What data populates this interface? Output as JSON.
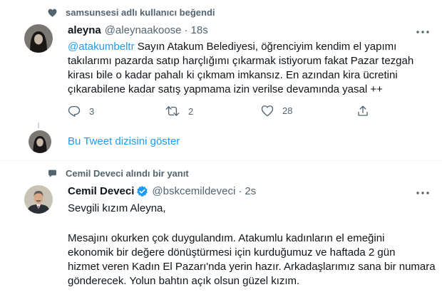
{
  "tweet1": {
    "social_context": "samsunsesi adlı kullanıcı beğendi",
    "author_name": "aleyna",
    "handle": "@aleynaakoose",
    "time": "18s",
    "mention": "@atakumbeltr",
    "lines": [
      " Sayın Atakum Belediyesi, öğrenciyim kendim el yapımı",
      "takılarımı pazarda satıp harçlığımı çıkarmak istiyorum fakat Pazar tezgah",
      "kirası bile o kadar pahalı ki çıkmam imkansız. En azından kira ücretini",
      "çıkarabilene kadar satış yapmama izin verilse devamında yasal ++"
    ],
    "reply_count": "3",
    "retweet_count": "2",
    "like_count": "28"
  },
  "thread": {
    "show_thread_label": "Bu Tweet dizisini göster"
  },
  "tweet2": {
    "social_context": "Cemil Deveci alındı bir yanıt",
    "author_name": "Cemil Deveci",
    "handle": "@bskcemildeveci",
    "time": "2s",
    "greeting": "Sevgili kızım Aleyna,",
    "lines": [
      "Mesajını okurken çok duygulandım. Atakumlu kadınların el emeğini",
      "ekonomik bir değere dönüştürmesi için kurduğumuz ve haftada 2 gün",
      "hizmet veren Kadın El Pazarı'nda yerin hazır. Arkadaşlarımız sana bir numara",
      "gönderecek. Yolun bahtın açık olsun güzel kızım."
    ]
  },
  "icons": {
    "like_context": "heart-icon",
    "reply_context": "speech-bubble-icon",
    "verified": "verified-badge-icon",
    "more": "more-icon",
    "reply": "reply-icon",
    "retweet": "retweet-icon",
    "like": "like-icon",
    "share": "share-icon"
  },
  "colors": {
    "accent": "#1d9bf0",
    "secondary_text": "#536471",
    "divider": "#eff3f4"
  }
}
